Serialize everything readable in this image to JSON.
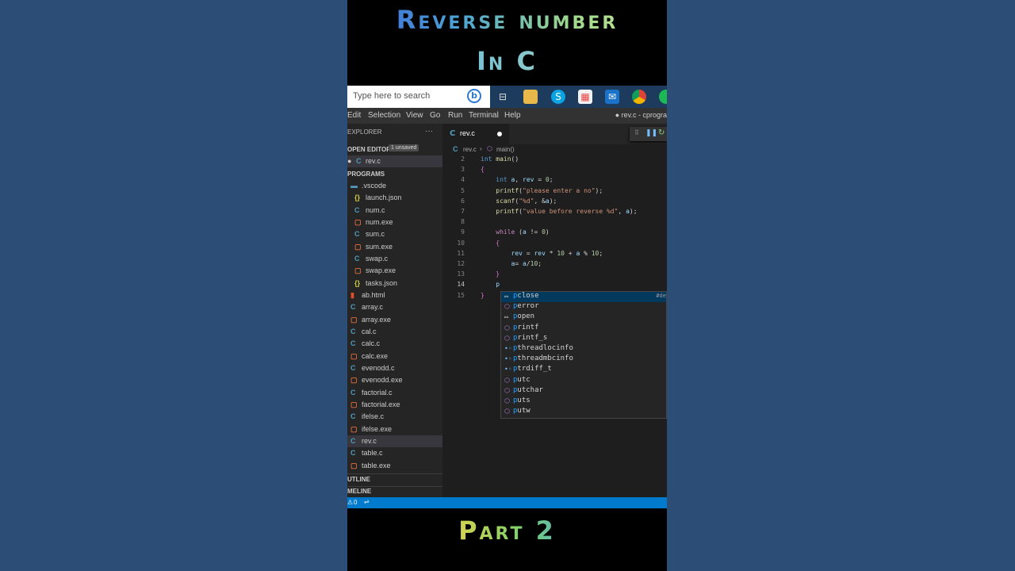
{
  "video": {
    "title_line1": "Reverse number",
    "title_line2": "In C",
    "footer": "Part 2"
  },
  "taskbar": {
    "search_placeholder": "Type here to search",
    "icons": [
      "bing-icon",
      "task-view-icon",
      "file-explorer-icon",
      "skype-icon",
      "store-icon",
      "mail-icon",
      "chrome-icon",
      "spotify-icon"
    ]
  },
  "menubar": {
    "items": [
      "Edit",
      "Selection",
      "View",
      "Go",
      "Run",
      "Terminal",
      "Help"
    ],
    "window_title": "● rev.c - cprogra"
  },
  "explorer": {
    "header": "EXPLORER",
    "open_editors_label": "OPEN EDITORS",
    "unsaved_badge": "1 unsaved",
    "open_file": "rev.c",
    "folder_label": "PROGRAMS",
    "files": [
      {
        "name": ".vscode",
        "icon": "folder-icon",
        "indent": 1
      },
      {
        "name": "launch.json",
        "icon": "json-icon",
        "indent": 2
      },
      {
        "name": "num.c",
        "icon": "c-icon",
        "indent": 2
      },
      {
        "name": "num.exe",
        "icon": "exe-icon",
        "indent": 2
      },
      {
        "name": "sum.c",
        "icon": "c-icon",
        "indent": 2
      },
      {
        "name": "sum.exe",
        "icon": "exe-icon",
        "indent": 2
      },
      {
        "name": "swap.c",
        "icon": "c-icon",
        "indent": 2
      },
      {
        "name": "swap.exe",
        "icon": "exe-icon",
        "indent": 2
      },
      {
        "name": "tasks.json",
        "icon": "json-icon",
        "indent": 2
      },
      {
        "name": "ab.html",
        "icon": "html-icon",
        "indent": 1
      },
      {
        "name": "array.c",
        "icon": "c-icon",
        "indent": 1
      },
      {
        "name": "array.exe",
        "icon": "exe-icon",
        "indent": 1
      },
      {
        "name": "cal.c",
        "icon": "c-icon",
        "indent": 1
      },
      {
        "name": "calc.c",
        "icon": "c-icon",
        "indent": 1
      },
      {
        "name": "calc.exe",
        "icon": "exe-icon",
        "indent": 1
      },
      {
        "name": "evenodd.c",
        "icon": "c-icon",
        "indent": 1
      },
      {
        "name": "evenodd.exe",
        "icon": "exe-icon",
        "indent": 1
      },
      {
        "name": "factorial.c",
        "icon": "c-icon",
        "indent": 1
      },
      {
        "name": "factorial.exe",
        "icon": "exe-icon",
        "indent": 1
      },
      {
        "name": "ifelse.c",
        "icon": "c-icon",
        "indent": 1
      },
      {
        "name": "ifelse.exe",
        "icon": "exe-icon",
        "indent": 1
      },
      {
        "name": "rev.c",
        "icon": "c-icon",
        "indent": 1,
        "selected": true
      },
      {
        "name": "table.c",
        "icon": "c-icon",
        "indent": 1
      },
      {
        "name": "table.exe",
        "icon": "exe-icon",
        "indent": 1
      }
    ],
    "outline_label": "UTLINE",
    "timeline_label": "MELINE"
  },
  "editor": {
    "tab_name": "rev.c",
    "breadcrumb_file": "rev.c",
    "breadcrumb_symbol": "main()",
    "current_line": 14,
    "lines": [
      {
        "n": 2,
        "code": "int main()"
      },
      {
        "n": 3,
        "code": "{"
      },
      {
        "n": 4,
        "code": "    int a, rev = 0;"
      },
      {
        "n": 5,
        "code": "    printf(\"please enter a no\");"
      },
      {
        "n": 6,
        "code": "    scanf(\"%d\", &a);"
      },
      {
        "n": 7,
        "code": "    printf(\"value before reverse %d\", a);"
      },
      {
        "n": 8,
        "code": ""
      },
      {
        "n": 9,
        "code": "    while (a != 0)"
      },
      {
        "n": 10,
        "code": "    {"
      },
      {
        "n": 11,
        "code": "        rev = rev * 10 + a % 10;"
      },
      {
        "n": 12,
        "code": "        a= a/10;"
      },
      {
        "n": 13,
        "code": "    }"
      },
      {
        "n": 14,
        "code": "    p"
      },
      {
        "n": 15,
        "code": "}"
      }
    ]
  },
  "suggestions": {
    "detail": "#de",
    "items": [
      {
        "label": "close",
        "prefix": "p",
        "icon": "keyword-icon",
        "active": true
      },
      {
        "label": "error",
        "prefix": "p",
        "icon": "method-icon"
      },
      {
        "label": "open",
        "prefix": "p",
        "icon": "keyword-icon"
      },
      {
        "label": "rintf",
        "prefix": "p",
        "icon": "method-icon"
      },
      {
        "label": "rintf_s",
        "prefix": "p",
        "icon": "method-icon"
      },
      {
        "label": "threadlocinfo",
        "prefix": "p",
        "icon": "type-icon"
      },
      {
        "label": "threadmbcinfo",
        "prefix": "p",
        "icon": "type-icon"
      },
      {
        "label": "trdiff_t",
        "prefix": "p",
        "icon": "type-icon"
      },
      {
        "label": "utc",
        "prefix": "p",
        "icon": "method-icon"
      },
      {
        "label": "utchar",
        "prefix": "p",
        "icon": "method-icon"
      },
      {
        "label": "uts",
        "prefix": "p",
        "icon": "method-icon"
      },
      {
        "label": "utw",
        "prefix": "p",
        "icon": "method-icon"
      }
    ]
  },
  "statusbar": {
    "warnings": "0"
  }
}
